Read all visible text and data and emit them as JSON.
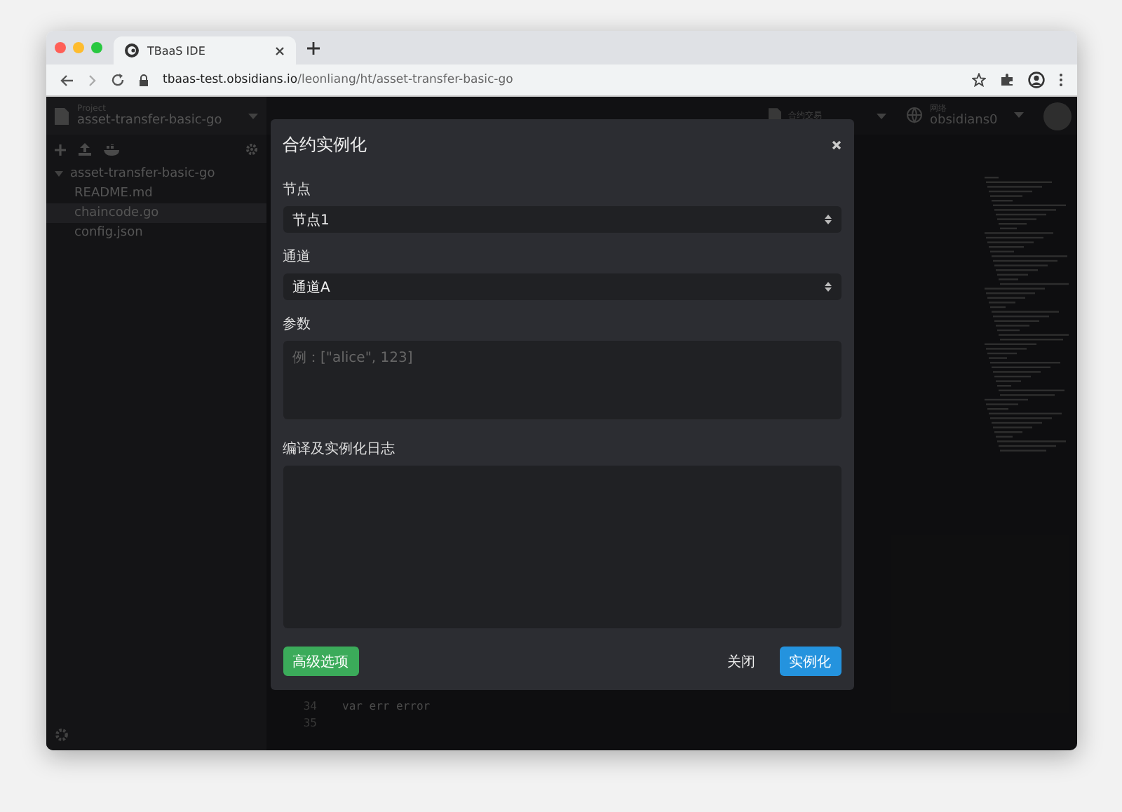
{
  "browser": {
    "tab_title": "TBaaS IDE",
    "url_host": "tbaas-test.obsidians.io",
    "url_path": "/leonliang/ht/asset-transfer-basic-go"
  },
  "project": {
    "label": "Project",
    "name": "asset-transfer-basic-go"
  },
  "header": {
    "selectors": [
      {
        "label": "合约交易",
        "kind": "file"
      },
      {
        "label": "网络",
        "value": "obsidians0",
        "kind": "globe"
      }
    ]
  },
  "file_tree": [
    {
      "name": "asset-transfer-basic-go",
      "expanded": true,
      "selected": false,
      "children": [
        {
          "name": "README.md",
          "selected": false
        },
        {
          "name": "chaincode.go",
          "selected": true
        },
        {
          "name": "config.json",
          "selected": false
        }
      ]
    }
  ],
  "editor": {
    "lines": [
      {
        "number": "34",
        "code": "    var err error"
      },
      {
        "number": "35"
      }
    ]
  },
  "modal": {
    "title": "合约实例化",
    "fields": [
      {
        "kind": "select",
        "label": "节点",
        "value": "节点1"
      },
      {
        "kind": "select",
        "label": "通道",
        "value": "通道A"
      },
      {
        "kind": "textarea",
        "label": "参数",
        "placeholder": "例：[\"alice\", 123]"
      },
      {
        "kind": "log",
        "label": "编译及实例化日志"
      }
    ],
    "buttons": [
      {
        "label": "高级选项",
        "kind": "success"
      },
      {
        "label": "关闭",
        "kind": "plain"
      },
      {
        "label": "实例化",
        "kind": "primary"
      }
    ]
  }
}
